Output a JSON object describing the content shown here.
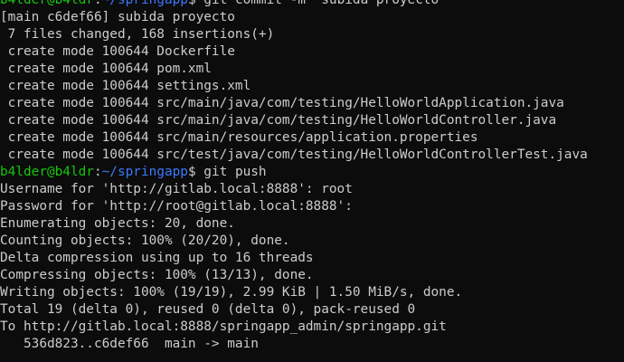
{
  "terminal": {
    "colors": {
      "background": "#0c0c0c",
      "foreground": "#cccccc",
      "prompt_user": "#16c60c",
      "prompt_path": "#3b78ff"
    },
    "prompt": {
      "user_host": "b4lder@b4ldr",
      "separator": ":",
      "path": "~/springapp",
      "dollar": "$"
    },
    "commands": {
      "commit": " git commit -m \"subida proyecto\"",
      "push": " git push"
    },
    "commit_output": [
      "[main c6def66] subida proyecto",
      " 7 files changed, 168 insertions(+)",
      " create mode 100644 Dockerfile",
      " create mode 100644 pom.xml",
      " create mode 100644 settings.xml",
      " create mode 100644 src/main/java/com/testing/HelloWorldApplication.java",
      " create mode 100644 src/main/java/com/testing/HelloWorldController.java",
      " create mode 100644 src/main/resources/application.properties",
      " create mode 100644 src/test/java/com/testing/HelloWorldControllerTest.java"
    ],
    "push_output": [
      "Username for 'http://gitlab.local:8888': root",
      "Password for 'http://root@gitlab.local:8888':",
      "Enumerating objects: 20, done.",
      "Counting objects: 100% (20/20), done.",
      "Delta compression using up to 16 threads",
      "Compressing objects: 100% (13/13), done.",
      "Writing objects: 100% (19/19), 2.99 KiB | 1.50 MiB/s, done.",
      "Total 19 (delta 0), reused 0 (delta 0), pack-reused 0",
      "To http://gitlab.local:8888/springapp_admin/springapp.git",
      "   536d823..c6def66  main -> main"
    ]
  }
}
